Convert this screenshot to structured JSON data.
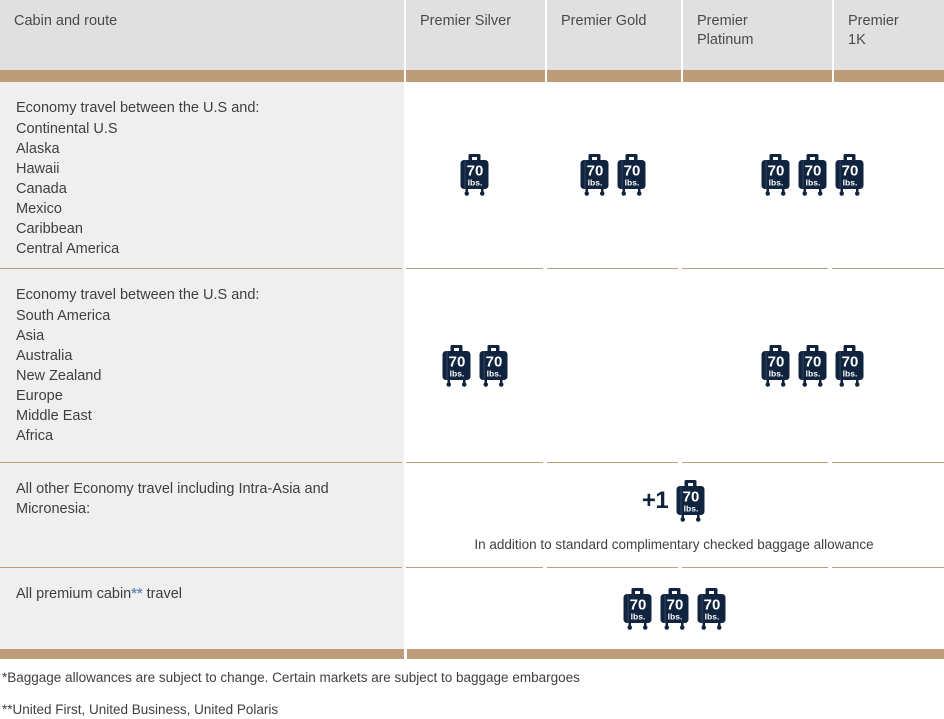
{
  "table": {
    "columns": [
      {
        "key": "cabin",
        "label": "Cabin and route"
      },
      {
        "key": "silver",
        "label": "Premier Silver"
      },
      {
        "key": "gold",
        "label": "Premier Gold"
      },
      {
        "key": "platinum",
        "label": "Premier\nPlatinum",
        "line1": "Premier",
        "line2": "Platinum"
      },
      {
        "key": "onek",
        "label": "Premier\n1K",
        "line1": "Premier",
        "line2": "1K"
      }
    ],
    "rows": [
      {
        "id": "row-economy-domestic",
        "lead": "Economy travel between the U.S and:",
        "destinations": [
          "Continental U.S",
          "Alaska",
          "Hawaii",
          "Canada",
          "Mexico",
          "Caribbean",
          "Central America"
        ],
        "silver_bags": 1,
        "gold_bags": 2,
        "platinum_1k_bags": 3
      },
      {
        "id": "row-economy-international",
        "lead": "Economy travel between the U.S and:",
        "destinations": [
          "South America",
          "Asia",
          "Australia",
          "New Zealand",
          "Europe",
          "Middle East",
          "Africa"
        ],
        "silver_bags": 2,
        "gold_bags": 0,
        "platinum_1k_bags": 3
      },
      {
        "id": "row-other-economy",
        "lead": "All other Economy travel including Intra-Asia and Micronesia:",
        "destinations": [],
        "plus_label": "+1",
        "plus_bags": 1,
        "caption": "In addition to standard complimentary checked baggage allowance"
      },
      {
        "id": "row-premium-cabin",
        "lead_before": "All premium cabin",
        "lead_marker": "**",
        "lead_after": " travel",
        "destinations": [],
        "all_bags": 3
      }
    ]
  },
  "bag_icon": {
    "weight": "70",
    "unit": "lbs.",
    "name": "checked-bag-icon",
    "color": "#10243f"
  },
  "footnotes": [
    "*Baggage allowances are subject to change. Certain markets are subject to baggage embargoes",
    "**United First, United Business, United Polaris"
  ],
  "colors": {
    "header_bg": "#e0e0e0",
    "accent_tan": "#bd9d77",
    "label_cell_bg": "#efefef",
    "bag_navy": "#10243f",
    "marker_blue": "#6b8fb5"
  }
}
